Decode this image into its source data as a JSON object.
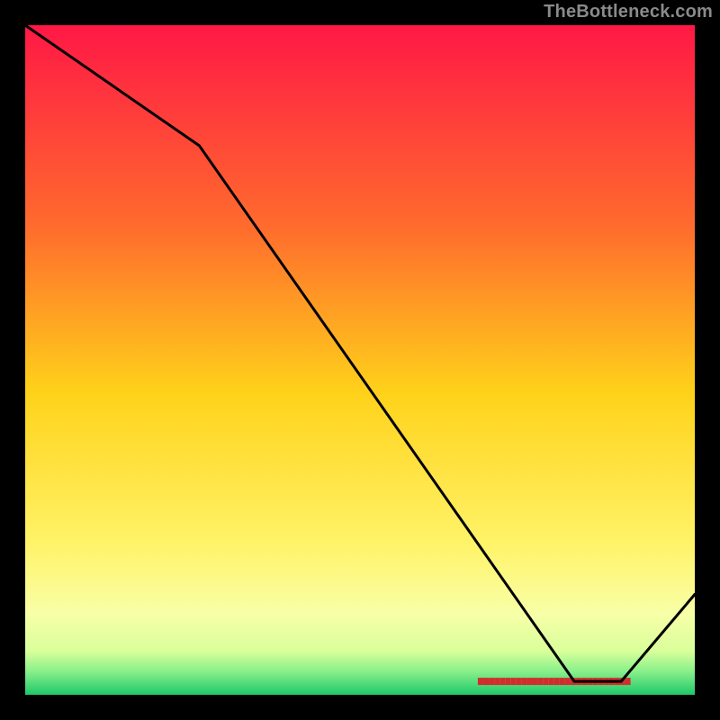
{
  "attribution": "TheBottleneck.com",
  "chart_data": {
    "type": "line",
    "title": "",
    "xlabel": "",
    "ylabel": "",
    "xlim": [
      0,
      100
    ],
    "ylim": [
      0,
      100
    ],
    "x": [
      0,
      26,
      82,
      89,
      100
    ],
    "values": [
      100,
      82,
      2,
      2,
      15
    ],
    "optimal_band": {
      "x_start": 68,
      "x_end": 90,
      "color": "#d12d2d"
    },
    "background_gradient": {
      "stops": [
        {
          "offset": 0.0,
          "color": "#ff1846"
        },
        {
          "offset": 0.3,
          "color": "#ff6b2d"
        },
        {
          "offset": 0.55,
          "color": "#ffd21a"
        },
        {
          "offset": 0.78,
          "color": "#fff46b"
        },
        {
          "offset": 0.88,
          "color": "#f8ffa8"
        },
        {
          "offset": 0.935,
          "color": "#d8ff9a"
        },
        {
          "offset": 0.965,
          "color": "#88f08a"
        },
        {
          "offset": 1.0,
          "color": "#1fc86a"
        }
      ]
    }
  }
}
